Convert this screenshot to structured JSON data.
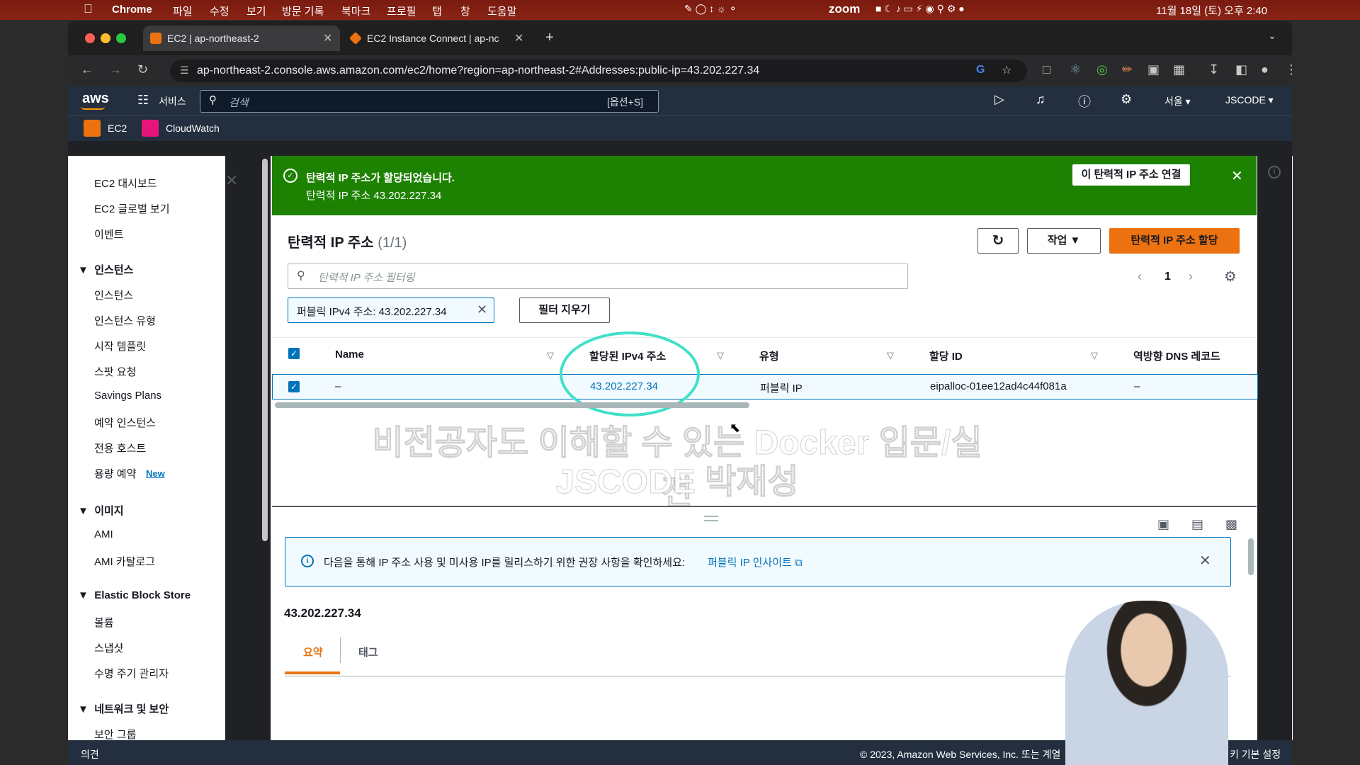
{
  "mac_menu": {
    "apple": "",
    "app": "Chrome",
    "items": [
      "파일",
      "수정",
      "보기",
      "방문 기록",
      "북마크",
      "프로필",
      "탭",
      "창",
      "도움말"
    ],
    "zoom": "zoom",
    "datetime": "11월 18일 (토) 오후 2:40"
  },
  "browser": {
    "tabs": [
      {
        "title": "EC2 | ap-northeast-2",
        "active": true
      },
      {
        "title": "EC2 Instance Connect | ap-nc",
        "active": false
      }
    ],
    "url": "ap-northeast-2.console.aws.amazon.com/ec2/home?region=ap-northeast-2#Addresses:public-ip=43.202.227.34"
  },
  "aws_header": {
    "logo": "aws",
    "services": "서비스",
    "search_placeholder": "검색",
    "search_shortcut": "[옵션+S]",
    "region": "서울",
    "account": "JSCODE",
    "favorites": [
      "EC2",
      "CloudWatch"
    ]
  },
  "sidebar": {
    "top": [
      "EC2 대시보드",
      "EC2 글로벌 보기",
      "이벤트"
    ],
    "sections": [
      {
        "title": "인스턴스",
        "items": [
          "인스턴스",
          "인스턴스 유형",
          "시작 템플릿",
          "스팟 요청",
          "Savings Plans",
          "예약 인스턴스",
          "전용 호스트",
          "용량 예약"
        ]
      },
      {
        "title": "이미지",
        "items": [
          "AMI",
          "AMI 카탈로그"
        ]
      },
      {
        "title": "Elastic Block Store",
        "items": [
          "볼륨",
          "스냅샷",
          "수명 주기 관리자"
        ]
      },
      {
        "title": "네트워크 및 보안",
        "items": [
          "보안 그룹"
        ]
      }
    ],
    "new_badge": "New"
  },
  "flash": {
    "title": "탄력적 IP 주소가 할당되었습니다.",
    "message": "탄력적 IP 주소 43.202.227.34",
    "action": "이 탄력적 IP 주소 연결"
  },
  "panel": {
    "title": "탄력적 IP 주소",
    "count": "(1/1)",
    "actions_label": "작업",
    "allocate_label": "탄력적 IP 주소 할당",
    "filter_placeholder": "탄력적 IP 주소 필터링",
    "filter_token": "퍼블릭 IPv4 주소: 43.202.227.34",
    "clear_filters": "필터 지우기",
    "page": "1"
  },
  "table": {
    "headers": [
      "Name",
      "할당된 IPv4 주소",
      "유형",
      "할당 ID",
      "역방향 DNS 레코드"
    ],
    "rows": [
      {
        "name": "–",
        "ipv4": "43.202.227.34",
        "type": "퍼블릭 IP",
        "allocation_id": "eipalloc-01ee12ad4c44f081a",
        "reverse_dns": "–"
      }
    ]
  },
  "detail": {
    "info": "다음을 통해 IP 주소 사용 및 미사용 IP를 릴리스하기 위한 권장 사항을 확인하세요:",
    "info_link": "퍼블릭 IP 인사이트",
    "ip": "43.202.227.34",
    "tabs": [
      "요약",
      "태그"
    ]
  },
  "watermark": {
    "line1": "비전공자도 이해할 수 있는 Docker 입문/실전",
    "line2": "JSCODE 박재성"
  },
  "footer": {
    "feedback": "의견",
    "copyright": "© 2023, Amazon Web Services, Inc. 또는 계열",
    "cookie": "키 기본 설정"
  },
  "colors": {
    "aws_nav": "#232f3e",
    "success": "#1d8102",
    "primary": "#ec7211",
    "link": "#0073bb"
  }
}
